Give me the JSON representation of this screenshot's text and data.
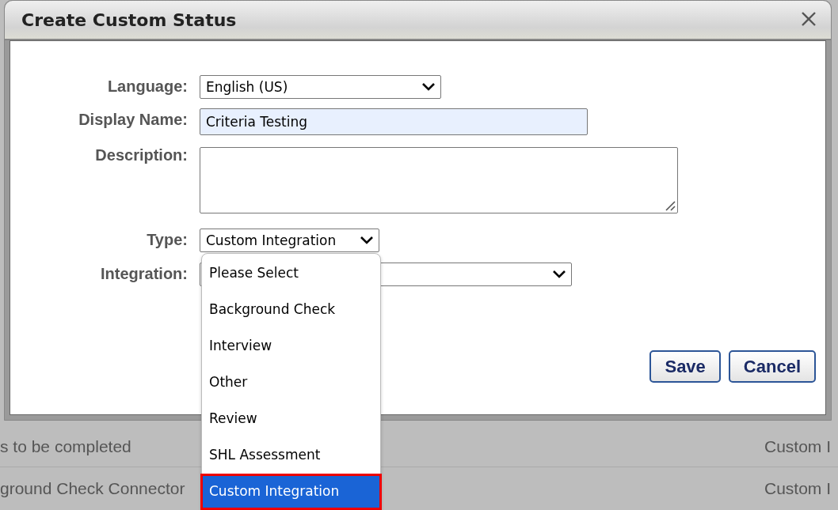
{
  "dialog": {
    "title": "Create Custom Status",
    "fields": [
      {
        "kind": "select",
        "label": "Language:",
        "value": "English (US)"
      },
      {
        "kind": "text",
        "label": "Display Name:",
        "value": "Criteria Testing"
      },
      {
        "kind": "textarea",
        "label": "Description:"
      },
      {
        "kind": "select",
        "label": "Type:",
        "value": "Custom Integration",
        "options": [
          {
            "label": "Please Select",
            "selected": false
          },
          {
            "label": "Background Check",
            "selected": false
          },
          {
            "label": "Interview",
            "selected": false
          },
          {
            "label": "Other",
            "selected": false
          },
          {
            "label": "Review",
            "selected": false
          },
          {
            "label": "SHL Assessment",
            "selected": false
          },
          {
            "label": "Custom Integration",
            "selected": true
          }
        ]
      },
      {
        "kind": "select",
        "label": "Integration:"
      }
    ],
    "buttons": [
      "Save",
      "Cancel"
    ]
  },
  "background_rows": [
    {
      "column_1": "s to be completed",
      "column_2": "Custom I"
    },
    {
      "column_1": "ground Check Connector",
      "column_2": "Custom I"
    }
  ]
}
